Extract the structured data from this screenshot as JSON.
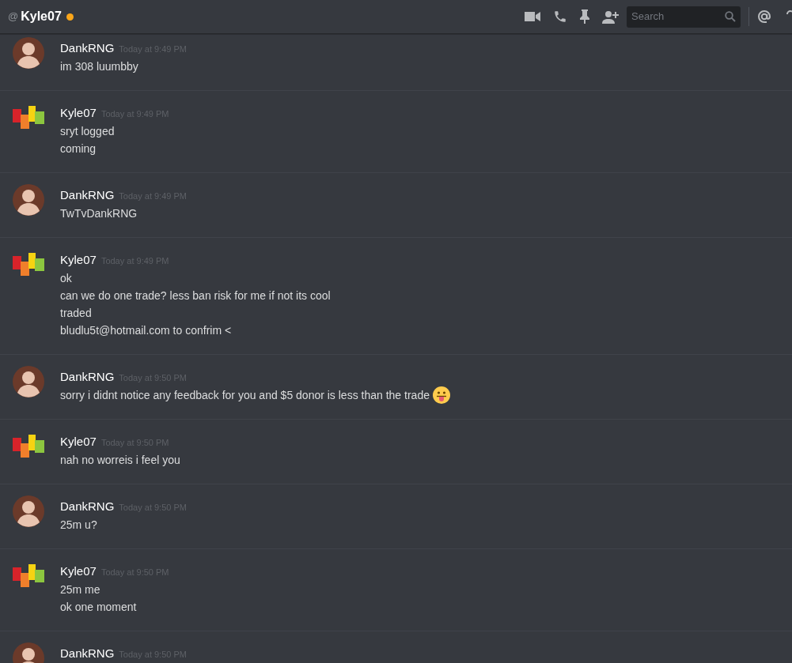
{
  "header": {
    "prefix": "@",
    "title": "Kyle07",
    "idle": true
  },
  "toolbar": {
    "search": {
      "placeholder": "Search"
    }
  },
  "messages": [
    {
      "author": "DankRNG",
      "kind": "person",
      "timestamp": "Today at 9:49 PM",
      "lines": [
        "im 308 luumbby"
      ]
    },
    {
      "author": "Kyle07",
      "kind": "tiles",
      "timestamp": "Today at 9:49 PM",
      "lines": [
        "sryt logged",
        "coming"
      ]
    },
    {
      "author": "DankRNG",
      "kind": "person",
      "timestamp": "Today at 9:49 PM",
      "lines": [
        "TwTvDankRNG"
      ]
    },
    {
      "author": "Kyle07",
      "kind": "tiles",
      "timestamp": "Today at 9:49 PM",
      "lines": [
        "ok",
        "can we do one trade? less ban risk for me if not its cool",
        "traded",
        "bludlu5t@hotmail.com to confrim <"
      ]
    },
    {
      "author": "DankRNG",
      "kind": "person",
      "timestamp": "Today at 9:50 PM",
      "lines": [
        "sorry i didnt notice any feedback for you and $5 donor is less than the trade"
      ],
      "emoji": true
    },
    {
      "author": "Kyle07",
      "kind": "tiles",
      "timestamp": "Today at 9:50 PM",
      "lines": [
        "nah no worreis i feel you"
      ]
    },
    {
      "author": "DankRNG",
      "kind": "person",
      "timestamp": "Today at 9:50 PM",
      "lines": [
        "25m u?"
      ]
    },
    {
      "author": "Kyle07",
      "kind": "tiles",
      "timestamp": "Today at 9:50 PM",
      "lines": [
        "25m me",
        "ok one moment"
      ]
    },
    {
      "author": "DankRNG",
      "kind": "person",
      "timestamp": "Today at 9:50 PM"
    }
  ]
}
